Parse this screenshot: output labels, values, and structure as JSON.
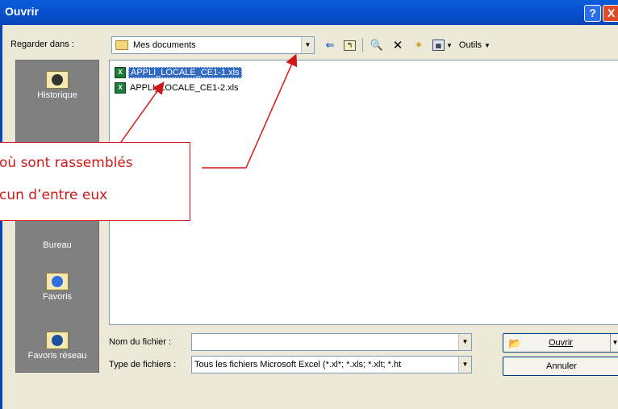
{
  "window": {
    "title": "Ouvrir",
    "help_button": "?",
    "close_button": "X"
  },
  "lookin": {
    "label": "Regarder dans :",
    "value": "Mes documents"
  },
  "toolbar": {
    "tools_label": "Outils"
  },
  "places": [
    {
      "label": "Historique",
      "icon": "history-icon"
    },
    {
      "label": "Bureau",
      "icon": "desktop-icon"
    },
    {
      "label": "Favoris",
      "icon": "favorites-icon"
    },
    {
      "label": "Favoris réseau",
      "icon": "network-favorites-icon"
    }
  ],
  "files": [
    {
      "name": "APPLI_LOCALE_CE1-1.xls",
      "selected": true
    },
    {
      "name": "APPLI_LOCALE_CE1-2.xls",
      "selected": false
    }
  ],
  "filename": {
    "label": "Nom du fichier :",
    "value": ""
  },
  "filetype": {
    "label": "Type de fichiers :",
    "value": "Tous les fichiers Microsoft Excel (*.xl*; *.xls; *.xlt; *.ht"
  },
  "buttons": {
    "open": "Ouvrir",
    "cancel": "Annuler"
  },
  "annotation": {
    "line1": "où sont rassemblés",
    "line2": "cun d’entre eux"
  },
  "colors": {
    "titlebar": "#0852d0",
    "selection": "#316ac5",
    "annotation": "#d01818",
    "places_bg": "#808080"
  }
}
